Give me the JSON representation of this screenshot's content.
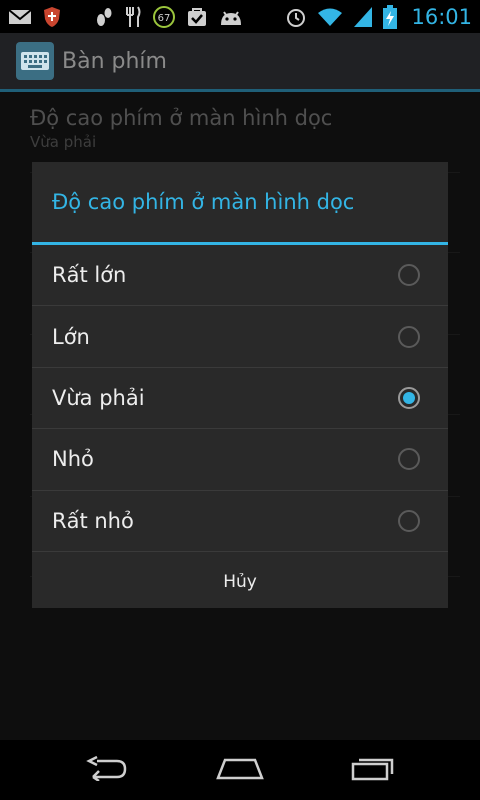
{
  "status_bar": {
    "time": "16:01",
    "battery_level_badge": "67",
    "left_icons": [
      "gmail-icon",
      "shield-icon",
      "footprint-icon",
      "restaurant-icon",
      "battery-percent-icon",
      "bag-check-icon",
      "android-icon"
    ],
    "right_icons": [
      "alarm-icon",
      "wifi-icon",
      "signal-icon",
      "battery-charging-icon"
    ]
  },
  "action_bar": {
    "title": "Bàn phím",
    "icon": "keyboard-icon"
  },
  "background_pref": {
    "title": "Độ cao phím ở màn hình dọc",
    "summary": "Vừa phải"
  },
  "dialog": {
    "title": "Độ cao phím ở màn hình dọc",
    "options": [
      {
        "label": "Rất lớn",
        "checked": false
      },
      {
        "label": "Lớn",
        "checked": false
      },
      {
        "label": "Vừa phải",
        "checked": true
      },
      {
        "label": "Nhỏ",
        "checked": false
      },
      {
        "label": "Rất nhỏ",
        "checked": false
      }
    ],
    "cancel_label": "Hủy"
  },
  "colors": {
    "accent": "#33b5e5",
    "dialog_bg": "#292929"
  }
}
